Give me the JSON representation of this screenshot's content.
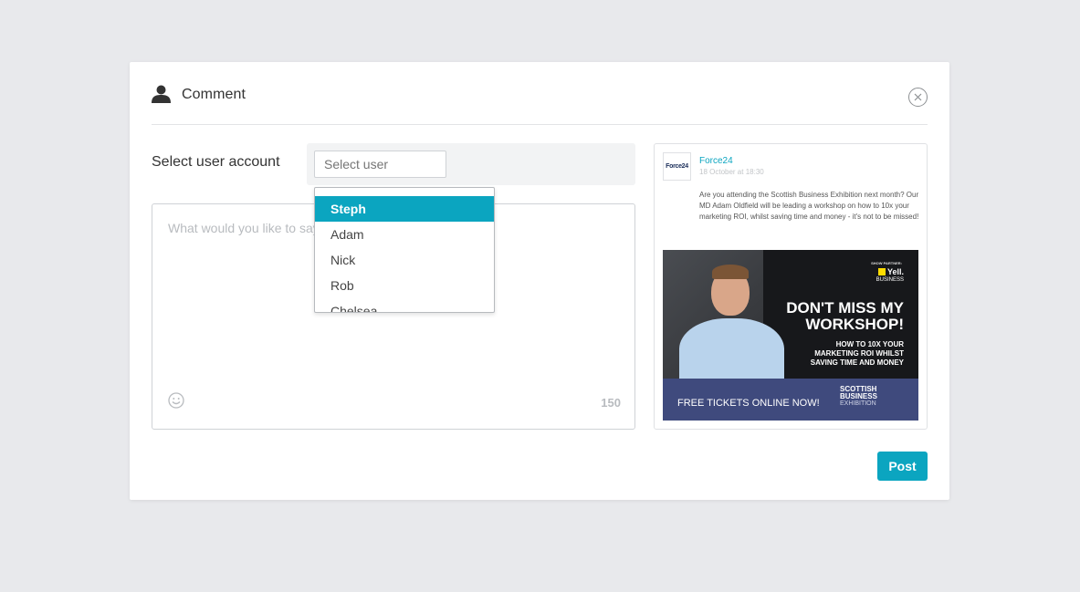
{
  "header": {
    "title": "Comment"
  },
  "form": {
    "select_label": "Select user account",
    "select_placeholder": "Select user",
    "textarea_placeholder": "What would you like to say?",
    "char_count": "150"
  },
  "dropdown": {
    "options": [
      "Steph",
      "Adam",
      "Nick",
      "Rob",
      "Chelsea"
    ],
    "highlighted": "Steph"
  },
  "preview": {
    "logo_text": "Force24",
    "account_name": "Force24",
    "date": "18 October at 18:30",
    "post_text": "Are you attending the Scottish Business Exhibition next month? Our MD Adam Oldfield will be leading a workshop on how to 10x your marketing ROI, whilst saving time and money - it's not to be missed!",
    "image": {
      "show_partner": "SHOW PARTNER:",
      "yell_brand": "Yell.",
      "yell_sub": "BUSINESS",
      "headline_1": "DON'T MISS MY",
      "headline_2": "WORKSHOP!",
      "subline_1": "HOW TO 10X YOUR",
      "subline_2": "MARKETING ROI WHILST",
      "subline_3": "SAVING TIME AND MONEY",
      "free_tickets": "FREE TICKETS ONLINE NOW!",
      "sbe_1": "SCOTTISH",
      "sbe_2": "BUSINESS",
      "sbe_3": "EXHIBITION"
    }
  },
  "actions": {
    "post_label": "Post"
  },
  "colors": {
    "accent": "#0ba5c0",
    "background": "#e8e9ec",
    "banner": "#3f4a7d"
  }
}
